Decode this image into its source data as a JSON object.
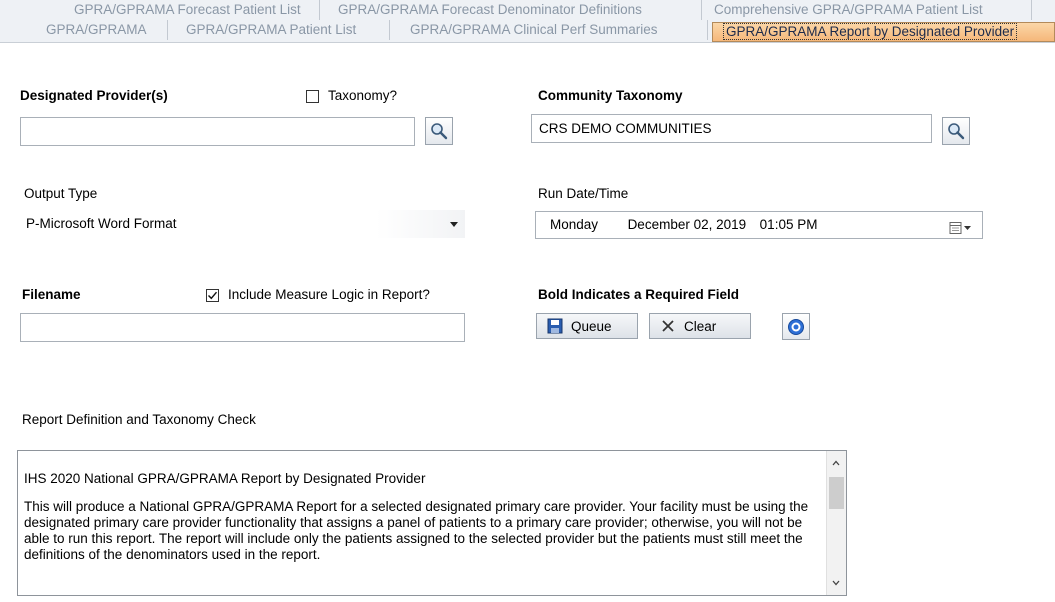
{
  "tabs": {
    "row1": [
      {
        "label": "GPRA/GPRAMA Forecast Patient List"
      },
      {
        "label": "GPRA/GPRAMA Forecast Denominator Definitions"
      },
      {
        "label": "Comprehensive GPRA/GPRAMA Patient List"
      }
    ],
    "row2": [
      {
        "label": "GPRA/GPRAMA"
      },
      {
        "label": "GPRA/GPRAMA Patient List"
      },
      {
        "label": "GPRA/GPRAMA Clinical Perf Summaries"
      },
      {
        "label": "GPRA/GPRAMA Report by Designated Provider",
        "active": true
      }
    ]
  },
  "form": {
    "designated_provider_label": "Designated Provider(s)",
    "designated_provider_value": "",
    "taxonomy_checkbox_label": "Taxonomy?",
    "taxonomy_checked": false,
    "community_taxonomy_label": "Community Taxonomy",
    "community_taxonomy_value": "CRS DEMO COMMUNITIES",
    "output_type_label": "Output Type",
    "output_type_value": "P-Microsoft Word Format",
    "run_datetime_label": "Run Date/Time",
    "run_day": "Monday",
    "run_date": "December 02, 2019",
    "run_time": "01:05 PM",
    "filename_label": "Filename",
    "filename_value": "",
    "include_logic_label": "Include Measure Logic in Report?",
    "include_logic_checked": true,
    "required_note": "Bold Indicates a Required Field"
  },
  "buttons": {
    "queue_label": "Queue",
    "clear_label": "Clear"
  },
  "report_definition": {
    "label": "Report Definition and Taxonomy Check",
    "title": "IHS 2020 National GPRA/GPRAMA Report by Designated Provider",
    "body": "This will produce a National GPRA/GPRAMA Report for a selected designated primary care provider.  Your facility must be using the designated primary care provider functionality that assigns a panel of patients to a primary care provider; otherwise, you will not be able to run this report.  The report will include only the patients assigned to the selected provider but the patients must still meet the definitions of the denominators used in the report."
  },
  "colors": {
    "active_tab": "#f5b77a",
    "inactive_tab_text": "#8a97a6",
    "help_icon": "#2d6fd6",
    "save_icon": "#2a5db0"
  },
  "icons": [
    "magnifier-icon",
    "calendar-icon",
    "save-icon",
    "x-icon",
    "help-icon",
    "chevron-up-icon",
    "chevron-down-icon"
  ]
}
